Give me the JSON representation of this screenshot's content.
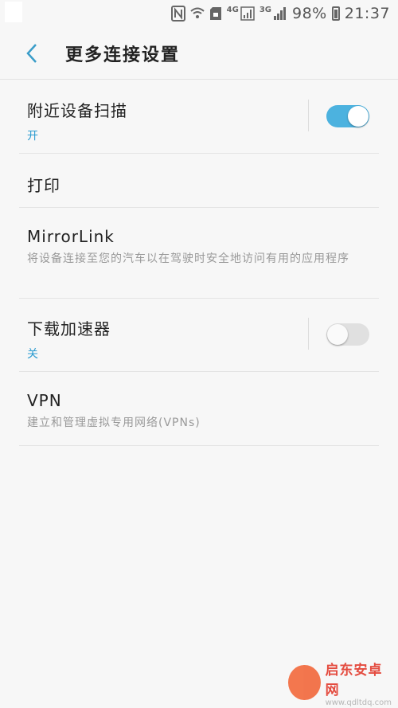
{
  "status_bar": {
    "network_label_1": "4G",
    "network_label_2": "3G",
    "battery": "98%",
    "time": "21:37"
  },
  "header": {
    "title": "更多连接设置"
  },
  "items": [
    {
      "title": "附近设备扫描",
      "status": "开",
      "toggle": true
    },
    {
      "title": "打印"
    },
    {
      "title": "MirrorLink",
      "subtitle": "将设备连接至您的汽车以在驾驶时安全地访问有用的应用程序"
    },
    {
      "title": "下载加速器",
      "status": "关",
      "toggle": false
    },
    {
      "title": "VPN",
      "subtitle": "建立和管理虚拟专用网络(VPNs)"
    }
  ],
  "watermark": {
    "line1": "启东安卓网",
    "line2": "www.qdltdq.com"
  }
}
